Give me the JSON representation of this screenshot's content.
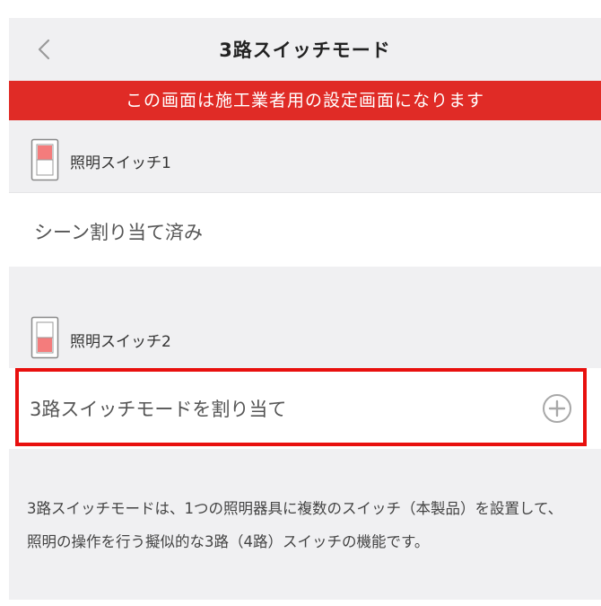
{
  "nav": {
    "title": "3路スイッチモード",
    "back_icon": "chevron-left-icon"
  },
  "warning_banner": {
    "text": "この画面は施工業者用の設定画面になります",
    "color": "#e02b26"
  },
  "switch1": {
    "label": "照明スイッチ1",
    "icon": "rocker-switch-icon",
    "active_half": "top",
    "status": "シーン割り当て済み"
  },
  "switch2": {
    "label": "照明スイッチ2",
    "icon": "rocker-switch-icon",
    "active_half": "bottom",
    "action": "3路スイッチモードを割り当て",
    "action_icon": "plus-circle-icon"
  },
  "description": "3路スイッチモードは、1つの照明器具に複数のスイッチ（本製品）を設置して、照明の操作を行う擬似的な3路（4路）スイッチの機能です。",
  "colors": {
    "highlight_border": "#e8100e",
    "switch_active": "#f47c7c",
    "section_bg": "#f0f0f2"
  }
}
